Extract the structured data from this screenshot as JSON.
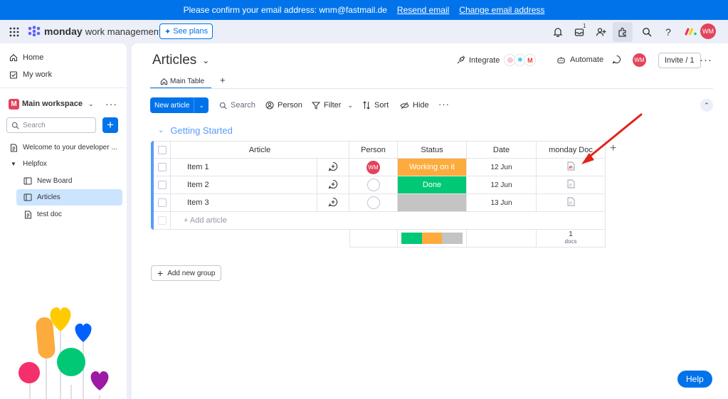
{
  "banner": {
    "text": "Please confirm your email address: wnm@fastmail.de",
    "resend": "Resend email",
    "change": "Change email address"
  },
  "topbar": {
    "brand_bold": "monday",
    "brand_rest": "work management",
    "see_plans": "See plans",
    "inbox_badge": "1",
    "avatar_initials": "WM"
  },
  "sidebar": {
    "home": "Home",
    "my_work": "My work",
    "workspace_letter": "M",
    "workspace_name": "Main workspace",
    "search_placeholder": "Search",
    "items": [
      {
        "label": "Welcome to your developer ..."
      },
      {
        "label": "Helpfox"
      },
      {
        "label": "New Board"
      },
      {
        "label": "Articles"
      },
      {
        "label": "test doc"
      }
    ]
  },
  "board": {
    "title": "Articles",
    "integrate": "Integrate",
    "automate": "Automate",
    "avatar_initials": "WM",
    "invite": "Invite / 1",
    "tab_main": "Main Table",
    "tab_add": "+",
    "new_article": "New article",
    "search": "Search",
    "person": "Person",
    "filter": "Filter",
    "sort": "Sort",
    "hide": "Hide",
    "group_title": "Getting Started",
    "columns": {
      "article": "Article",
      "person": "Person",
      "status": "Status",
      "date": "Date",
      "doc": "monday Doc"
    },
    "rows": [
      {
        "name": "Item 1",
        "person": "WM",
        "status": "Working on it",
        "date": "12 Jun"
      },
      {
        "name": "Item 2",
        "person": "",
        "status": "Done",
        "date": "12 Jun"
      },
      {
        "name": "Item 3",
        "person": "",
        "status": "",
        "date": "13 Jun"
      }
    ],
    "add_article": "+ Add article",
    "summary_docs_count": "1",
    "summary_docs_label": "docs",
    "add_group": "Add new group",
    "help": "Help"
  },
  "colors": {
    "primary": "#0073ea",
    "working": "#fdab3d",
    "done": "#00c875",
    "empty_status": "#c4c4c4",
    "avatar": "#e2445c",
    "group": "#579bfc",
    "arrow": "#e2231a"
  }
}
